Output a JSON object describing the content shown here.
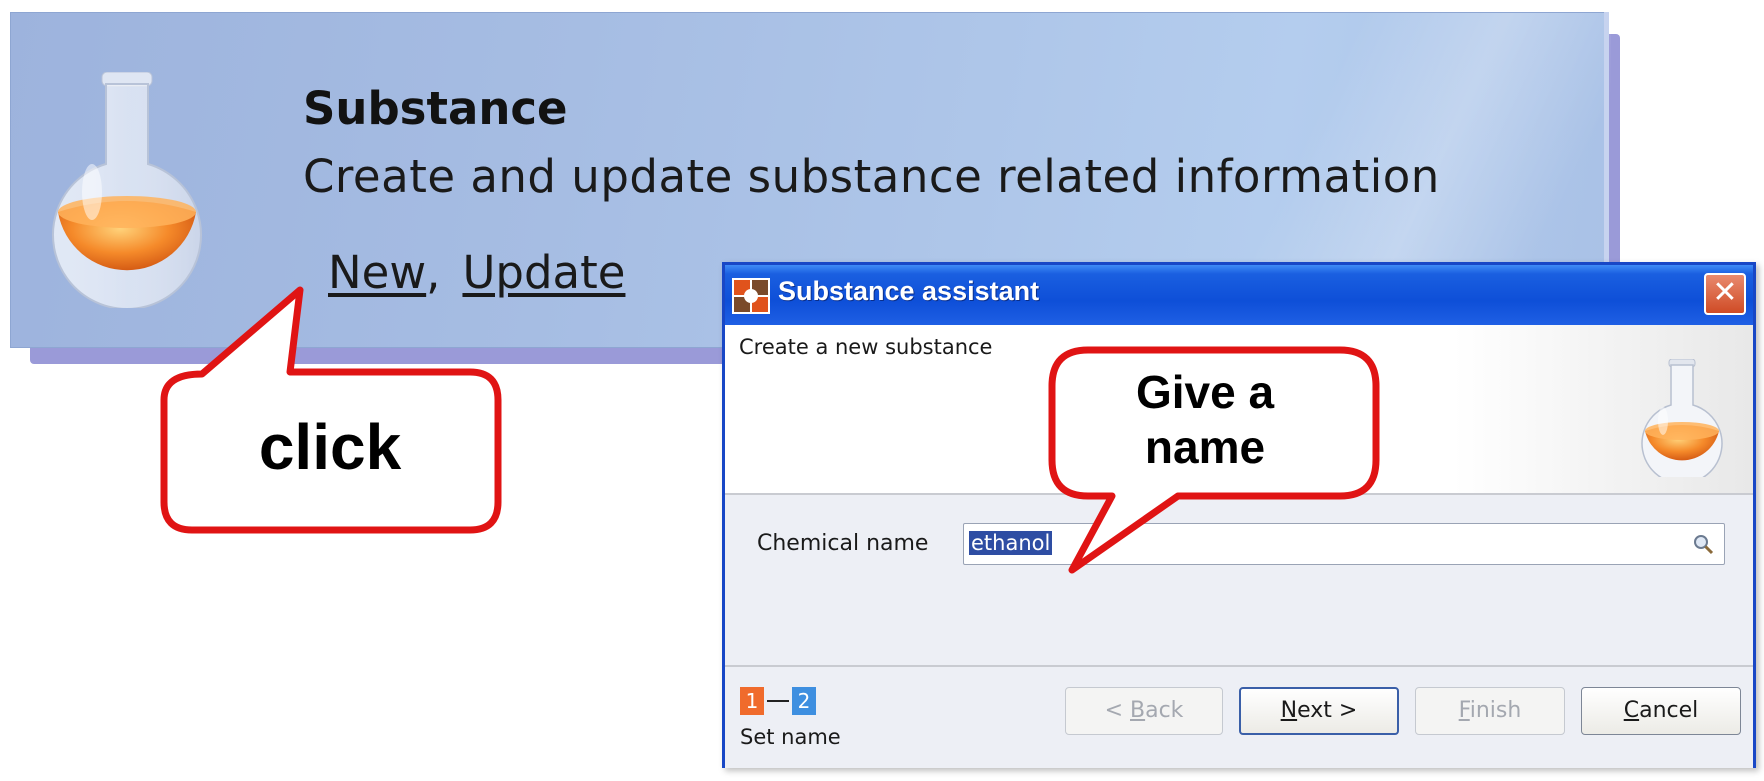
{
  "panel": {
    "title": "Substance",
    "description": "Create and update substance related information",
    "links": {
      "new": "New",
      "separator": ",",
      "update": "Update"
    }
  },
  "callouts": {
    "click": "click",
    "give_name_line1": "Give a",
    "give_name_line2": "name"
  },
  "dialog": {
    "title": "Substance assistant",
    "close_label": "✕",
    "header_text": "Create a new substance",
    "field_label": "Chemical name",
    "field_value": "ethanol",
    "steps": [
      "1",
      "2"
    ],
    "step_caption": "Set name",
    "buttons": {
      "back_prefix": "< ",
      "back_key": "B",
      "back_rest": "ack",
      "next_key": "N",
      "next_rest": "ext >",
      "finish_key": "F",
      "finish_rest": "inish",
      "cancel_key": "C",
      "cancel_rest": "ancel"
    }
  },
  "colors": {
    "panel_bg": "#a6bde3",
    "titlebar": "#0e4fd8",
    "callout_border": "#e01414",
    "selection": "#2e4da3",
    "step1": "#f06b2c",
    "step2": "#3e8fe0"
  },
  "icons": [
    "flask-icon",
    "app-icon",
    "close-icon",
    "search-icon"
  ]
}
